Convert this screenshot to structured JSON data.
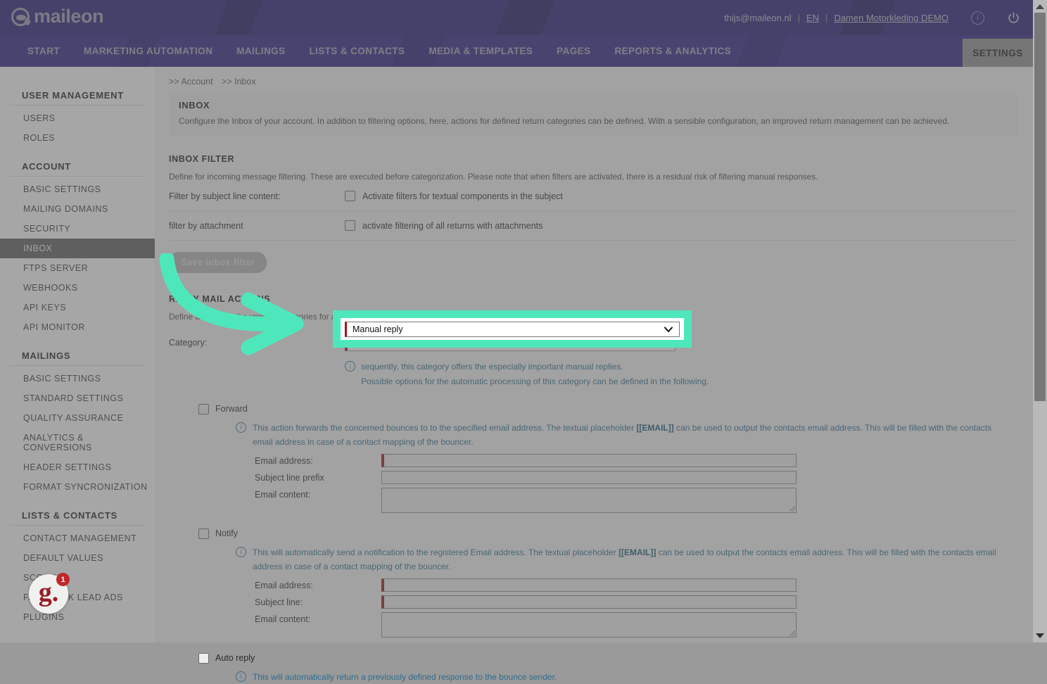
{
  "topbar": {
    "logo_text": "maileon",
    "user_email": "thijs@maileon.nl",
    "sep": "|",
    "language": "EN",
    "account": "Damen Motorkleding DEMO",
    "info_icon": "info-icon",
    "power_icon": "power-icon"
  },
  "nav": {
    "items": [
      "START",
      "MARKETING AUTOMATION",
      "MAILINGS",
      "LISTS & CONTACTS",
      "MEDIA & TEMPLATES",
      "PAGES",
      "REPORTS & ANALYTICS"
    ],
    "active_tab": "SETTINGS"
  },
  "sidebar": {
    "groups": [
      {
        "heading": "USER MANAGEMENT",
        "items": [
          {
            "label": "USERS",
            "active": false
          },
          {
            "label": "ROLES",
            "active": false
          }
        ]
      },
      {
        "heading": "ACCOUNT",
        "items": [
          {
            "label": "BASIC SETTINGS",
            "active": false
          },
          {
            "label": "MAILING DOMAINS",
            "active": false
          },
          {
            "label": "SECURITY",
            "active": false
          },
          {
            "label": "INBOX",
            "active": true
          },
          {
            "label": "FTPS SERVER",
            "active": false
          },
          {
            "label": "WEBHOOKS",
            "active": false
          },
          {
            "label": "API KEYS",
            "active": false
          },
          {
            "label": "API MONITOR",
            "active": false
          }
        ]
      },
      {
        "heading": "MAILINGS",
        "items": [
          {
            "label": "BASIC SETTINGS",
            "active": false
          },
          {
            "label": "STANDARD SETTINGS",
            "active": false
          },
          {
            "label": "QUALITY ASSURANCE",
            "active": false
          },
          {
            "label": "ANALYTICS & CONVERSIONS",
            "active": false
          },
          {
            "label": "HEADER SETTINGS",
            "active": false
          },
          {
            "label": "FORMAT SYNCRONIZATION",
            "active": false
          }
        ]
      },
      {
        "heading": "LISTS & CONTACTS",
        "items": [
          {
            "label": "CONTACT MANAGEMENT",
            "active": false
          },
          {
            "label": "DEFAULT VALUES",
            "active": false
          },
          {
            "label": "SCORING",
            "active": false
          },
          {
            "label": "FACEBOOK LEAD ADS",
            "active": false
          },
          {
            "label": "PLUGINS",
            "active": false
          }
        ]
      }
    ]
  },
  "breadcrumb": {
    "part1": ">> Account",
    "part2": ">> Inbox"
  },
  "page": {
    "title": "INBOX",
    "description": "Configure the Inbox of your account. In addition to filtering options, here, actions for defined return categories can be defined. With a sensible configuration, an improved return management can be achieved."
  },
  "inbox_filter": {
    "title": "INBOX FILTER",
    "description": "Define for incoming message filtering. These are executed before categorization. Please note that when filters are activated, there is a residual risk of filtering manual responses.",
    "rows": [
      {
        "label": "Filter by subject line content:",
        "checkbox_label": "Activate filters for textual components in the subject",
        "checked": false
      },
      {
        "label": "filter by attachment",
        "checkbox_label": "activate filtering of all returns with attachments",
        "checked": false
      }
    ],
    "save_button": "Save inbox filter"
  },
  "reply_mail_actions": {
    "title": "REPLY MAIL ACTIONS",
    "description": "Define actions for the various categories for automatic reply mail processing.",
    "category_label": "Category:",
    "category_value": "Manual reply",
    "category_options": [
      "Manual reply"
    ],
    "category_info_line1": "sequently, this category offers the especially important manual replies.",
    "category_info_line2": "Possible options for the automatic processing of this category can be defined in the following.",
    "actions": [
      {
        "name": "Forward",
        "checked": false,
        "info": "This action forwards the concerned bounces to to the specified email address. The textual placeholder [[EMAIL]] can be used to output the contacts email address. This will be filled with the contacts email address in case of a contact mapping of the bouncer.",
        "info_placeholder": "[[EMAIL]]",
        "fields": [
          {
            "label": "Email address:",
            "type": "input",
            "required": true,
            "value": ""
          },
          {
            "label": "Subject line prefix",
            "type": "input",
            "required": false,
            "value": ""
          },
          {
            "label": "Email content:",
            "type": "textarea",
            "required": false,
            "value": ""
          }
        ]
      },
      {
        "name": "Notify",
        "checked": false,
        "info": "This will automatically send a notification to the registered Email address. The textual placeholder [[EMAIL]] can be used to output the contacts email address. This will be filled with the contacts email address in case of a contact mapping of the bouncer.",
        "info_placeholder": "[[EMAIL]]",
        "fields": [
          {
            "label": "Email address:",
            "type": "input",
            "required": true,
            "value": ""
          },
          {
            "label": "Subject line:",
            "type": "input",
            "required": true,
            "value": ""
          },
          {
            "label": "Email content:",
            "type": "textarea",
            "required": false,
            "value": ""
          }
        ]
      },
      {
        "name": "Auto reply",
        "checked": false,
        "info": "This will automatically return a previously defined response to the bounce sender.",
        "info_placeholder": "",
        "fields": []
      }
    ]
  },
  "chat_widget": {
    "logo": "g.",
    "badge_count": "1"
  },
  "annotation": {
    "highlight_color": "#4ee7bb",
    "arrow_color": "#4ee7bb"
  },
  "colors": {
    "brand_dark": "#241b75",
    "brand_nav": "#2e2382",
    "accent_mint": "#4ee7bb",
    "required_red": "#a31515",
    "info_blue": "#2d6d8e"
  }
}
